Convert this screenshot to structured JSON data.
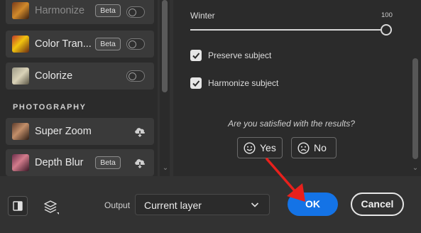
{
  "filters": {
    "harmonize": {
      "label": "Harmonize",
      "badge": "Beta",
      "enabled": false
    },
    "color_transfer": {
      "label": "Color Tran...",
      "badge": "Beta",
      "enabled": false
    },
    "colorize": {
      "label": "Colorize",
      "enabled": false
    },
    "section_photography": "PHOTOGRAPHY",
    "super_zoom": {
      "label": "Super Zoom",
      "icon": "cloud-download-icon"
    },
    "depth_blur": {
      "label": "Depth Blur",
      "badge": "Beta",
      "icon": "cloud-download-icon"
    }
  },
  "settings": {
    "slider": {
      "label": "Winter",
      "value": "100"
    },
    "preserve_subject": {
      "label": "Preserve subject",
      "checked": true
    },
    "harmonize_subject": {
      "label": "Harmonize subject",
      "checked": true
    }
  },
  "feedback": {
    "question": "Are you satisfied with the results?",
    "yes_label": "Yes",
    "no_label": "No"
  },
  "footer": {
    "output_label": "Output",
    "output_value": "Current layer",
    "ok_label": "OK",
    "cancel_label": "Cancel"
  },
  "colors": {
    "accent": "#1473e6",
    "annotation_arrow": "#e8201c",
    "panel_bg": "#2b2b2b"
  }
}
